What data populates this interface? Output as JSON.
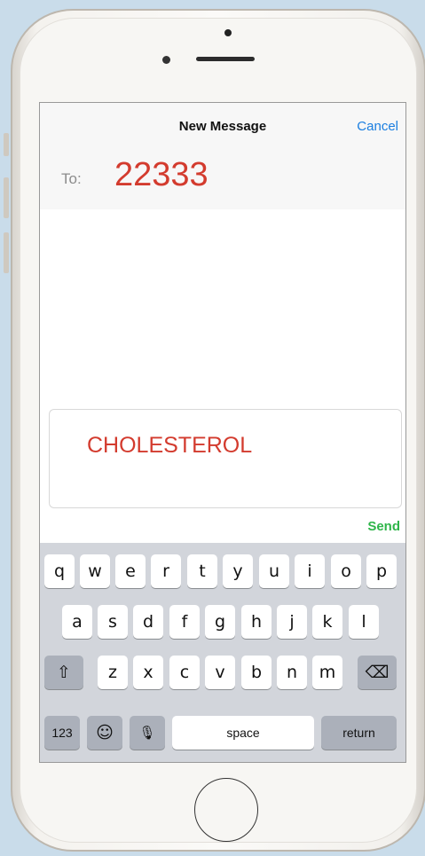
{
  "nav": {
    "title": "New Message",
    "cancel_label": "Cancel"
  },
  "recipient": {
    "label": "To:",
    "value": "22333"
  },
  "compose": {
    "text": "CHOLESTEROL",
    "send_label": "Send"
  },
  "keyboard": {
    "row1": [
      "q",
      "w",
      "e",
      "r",
      "t",
      "y",
      "u",
      "i",
      "o",
      "p"
    ],
    "row2": [
      "a",
      "s",
      "d",
      "f",
      "g",
      "h",
      "j",
      "k",
      "l"
    ],
    "row3": [
      "z",
      "x",
      "c",
      "v",
      "b",
      "n",
      "m"
    ],
    "shift_glyph": "⇧",
    "delete_glyph": "⌫",
    "numbers_label": "123",
    "emoji_glyph": "☺",
    "mic_glyph": "🎙",
    "space_label": "space",
    "return_label": "return"
  },
  "colors": {
    "accent": "#1a7ee0",
    "typed_text": "#d33b2e",
    "send": "#2fb54a"
  }
}
